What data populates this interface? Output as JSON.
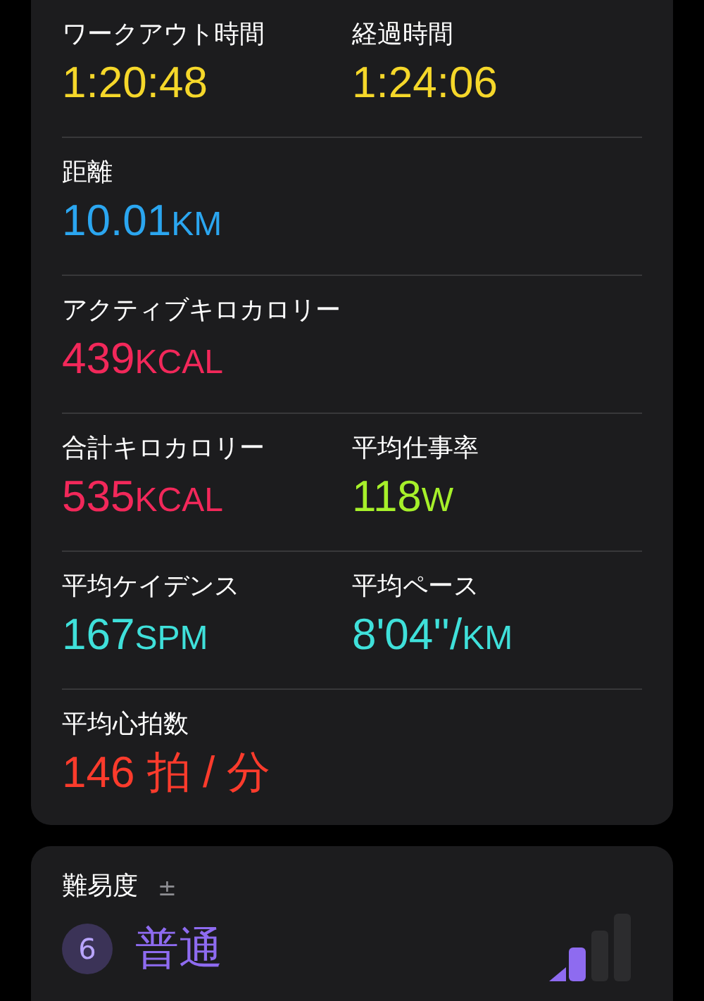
{
  "metrics_card": {
    "rows": [
      {
        "metrics": [
          {
            "label": "ワークアウト時間",
            "value": "1:20:48",
            "color": "#f5d72a"
          },
          {
            "label": "経過時間",
            "value": "1:24:06",
            "color": "#f5d72a"
          }
        ]
      },
      {
        "metrics": [
          {
            "label": "距離",
            "value": "10.01",
            "unit": "KM",
            "color": "#2ba6f0"
          }
        ]
      },
      {
        "metrics": [
          {
            "label": "アクティブキロカロリー",
            "value": "439",
            "unit": "KCAL",
            "color": "#f2285a"
          }
        ]
      },
      {
        "metrics": [
          {
            "label": "合計キロカロリー",
            "value": "535",
            "unit": "KCAL",
            "color": "#f2285a"
          },
          {
            "label": "平均仕事率",
            "value": "118",
            "unit": "W",
            "color": "#a6f02a"
          }
        ]
      },
      {
        "metrics": [
          {
            "label": "平均ケイデンス",
            "value": "167",
            "unit": "SPM",
            "color": "#3fe0da"
          },
          {
            "label": "平均ペース",
            "value": "8'04''/",
            "unit": "KM",
            "color": "#3fe0da"
          }
        ]
      },
      {
        "metrics": [
          {
            "label": "平均心拍数",
            "value": "146 拍 / 分",
            "color": "#fb3b2c"
          }
        ]
      }
    ]
  },
  "effort_card": {
    "title": "難易度",
    "adjust_symbol": "±",
    "score": "6",
    "rating": "普通"
  }
}
